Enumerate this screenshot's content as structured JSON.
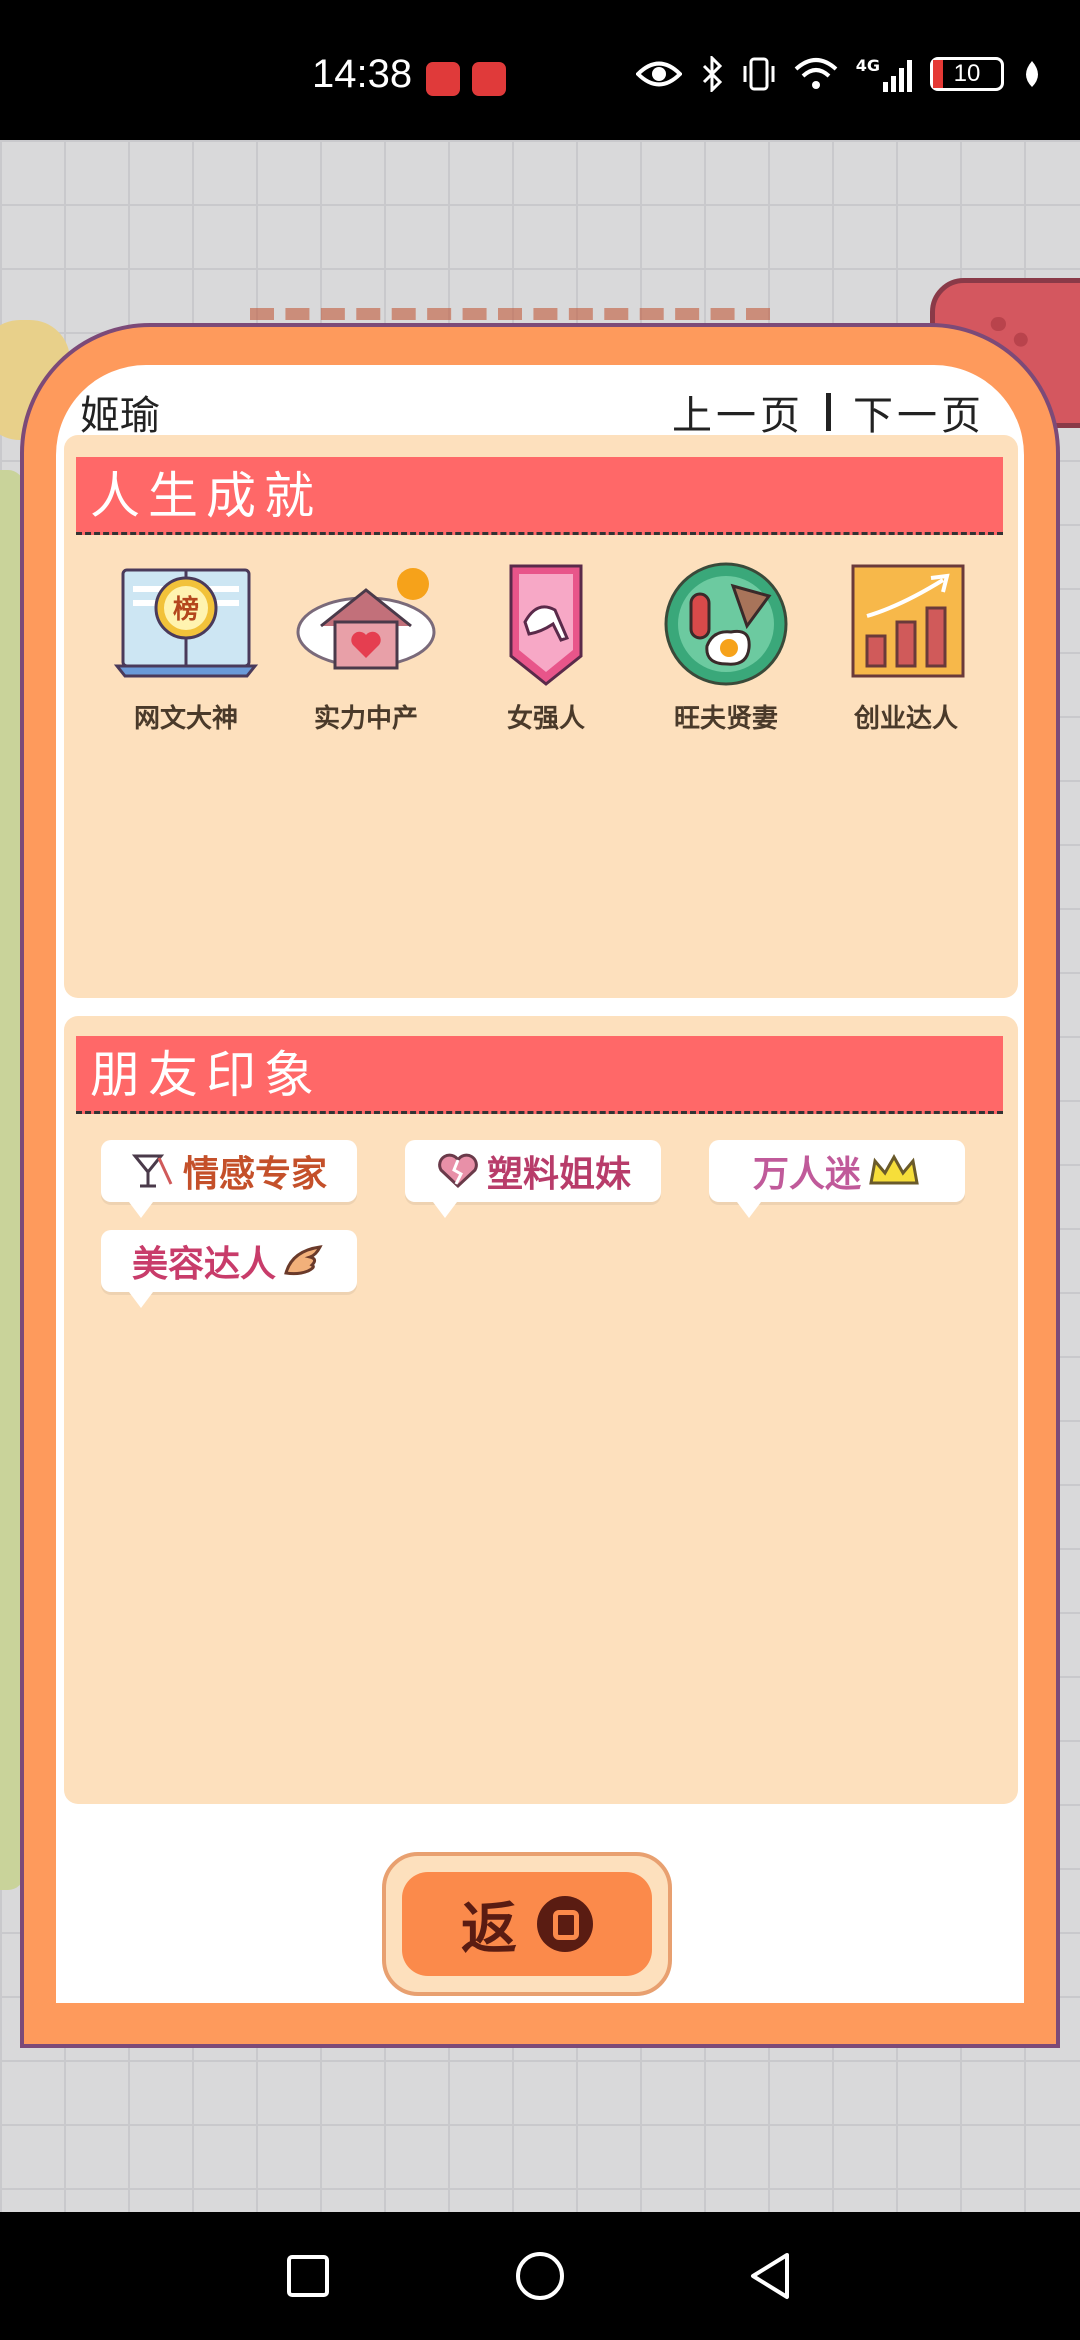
{
  "status_bar": {
    "time": "14:38",
    "badge_2": "小红书",
    "icons": [
      "eye-icon",
      "bluetooth-icon",
      "vibrate-icon",
      "wifi-icon",
      "signal-4g-icon"
    ],
    "network": "4G",
    "battery": "10"
  },
  "panel": {
    "name": "姬瑜",
    "prev_label": "上一页",
    "next_label": "下一页"
  },
  "achievements": {
    "title": "人生成就",
    "items": [
      {
        "label": "网文大神",
        "icon": "book-icon",
        "badge": "榜"
      },
      {
        "label": "实力中产",
        "icon": "house-heart-icon"
      },
      {
        "label": "女强人",
        "icon": "high-heel-icon"
      },
      {
        "label": "旺夫贤妻",
        "icon": "breakfast-plate-icon"
      },
      {
        "label": "创业达人",
        "icon": "growth-chart-icon"
      }
    ]
  },
  "impressions": {
    "title": "朋友印象",
    "tags": [
      {
        "label": "情感专家",
        "icon": "cocktail-icon",
        "color": "#c4502a"
      },
      {
        "label": "塑料姐妹",
        "icon": "broken-heart-icon",
        "color": "#b83c6a"
      },
      {
        "label": "万人迷",
        "icon": "crown-icon",
        "color": "#c05a9a"
      },
      {
        "label": "美容达人",
        "icon": "wing-icon",
        "color": "#c83c6a"
      }
    ]
  },
  "back_button": {
    "label": "返"
  },
  "colors": {
    "frame": "#fe9a5c",
    "section_header": "#ff6868",
    "panel_bg": "#fde0bd",
    "button": "#fb8a4b"
  }
}
